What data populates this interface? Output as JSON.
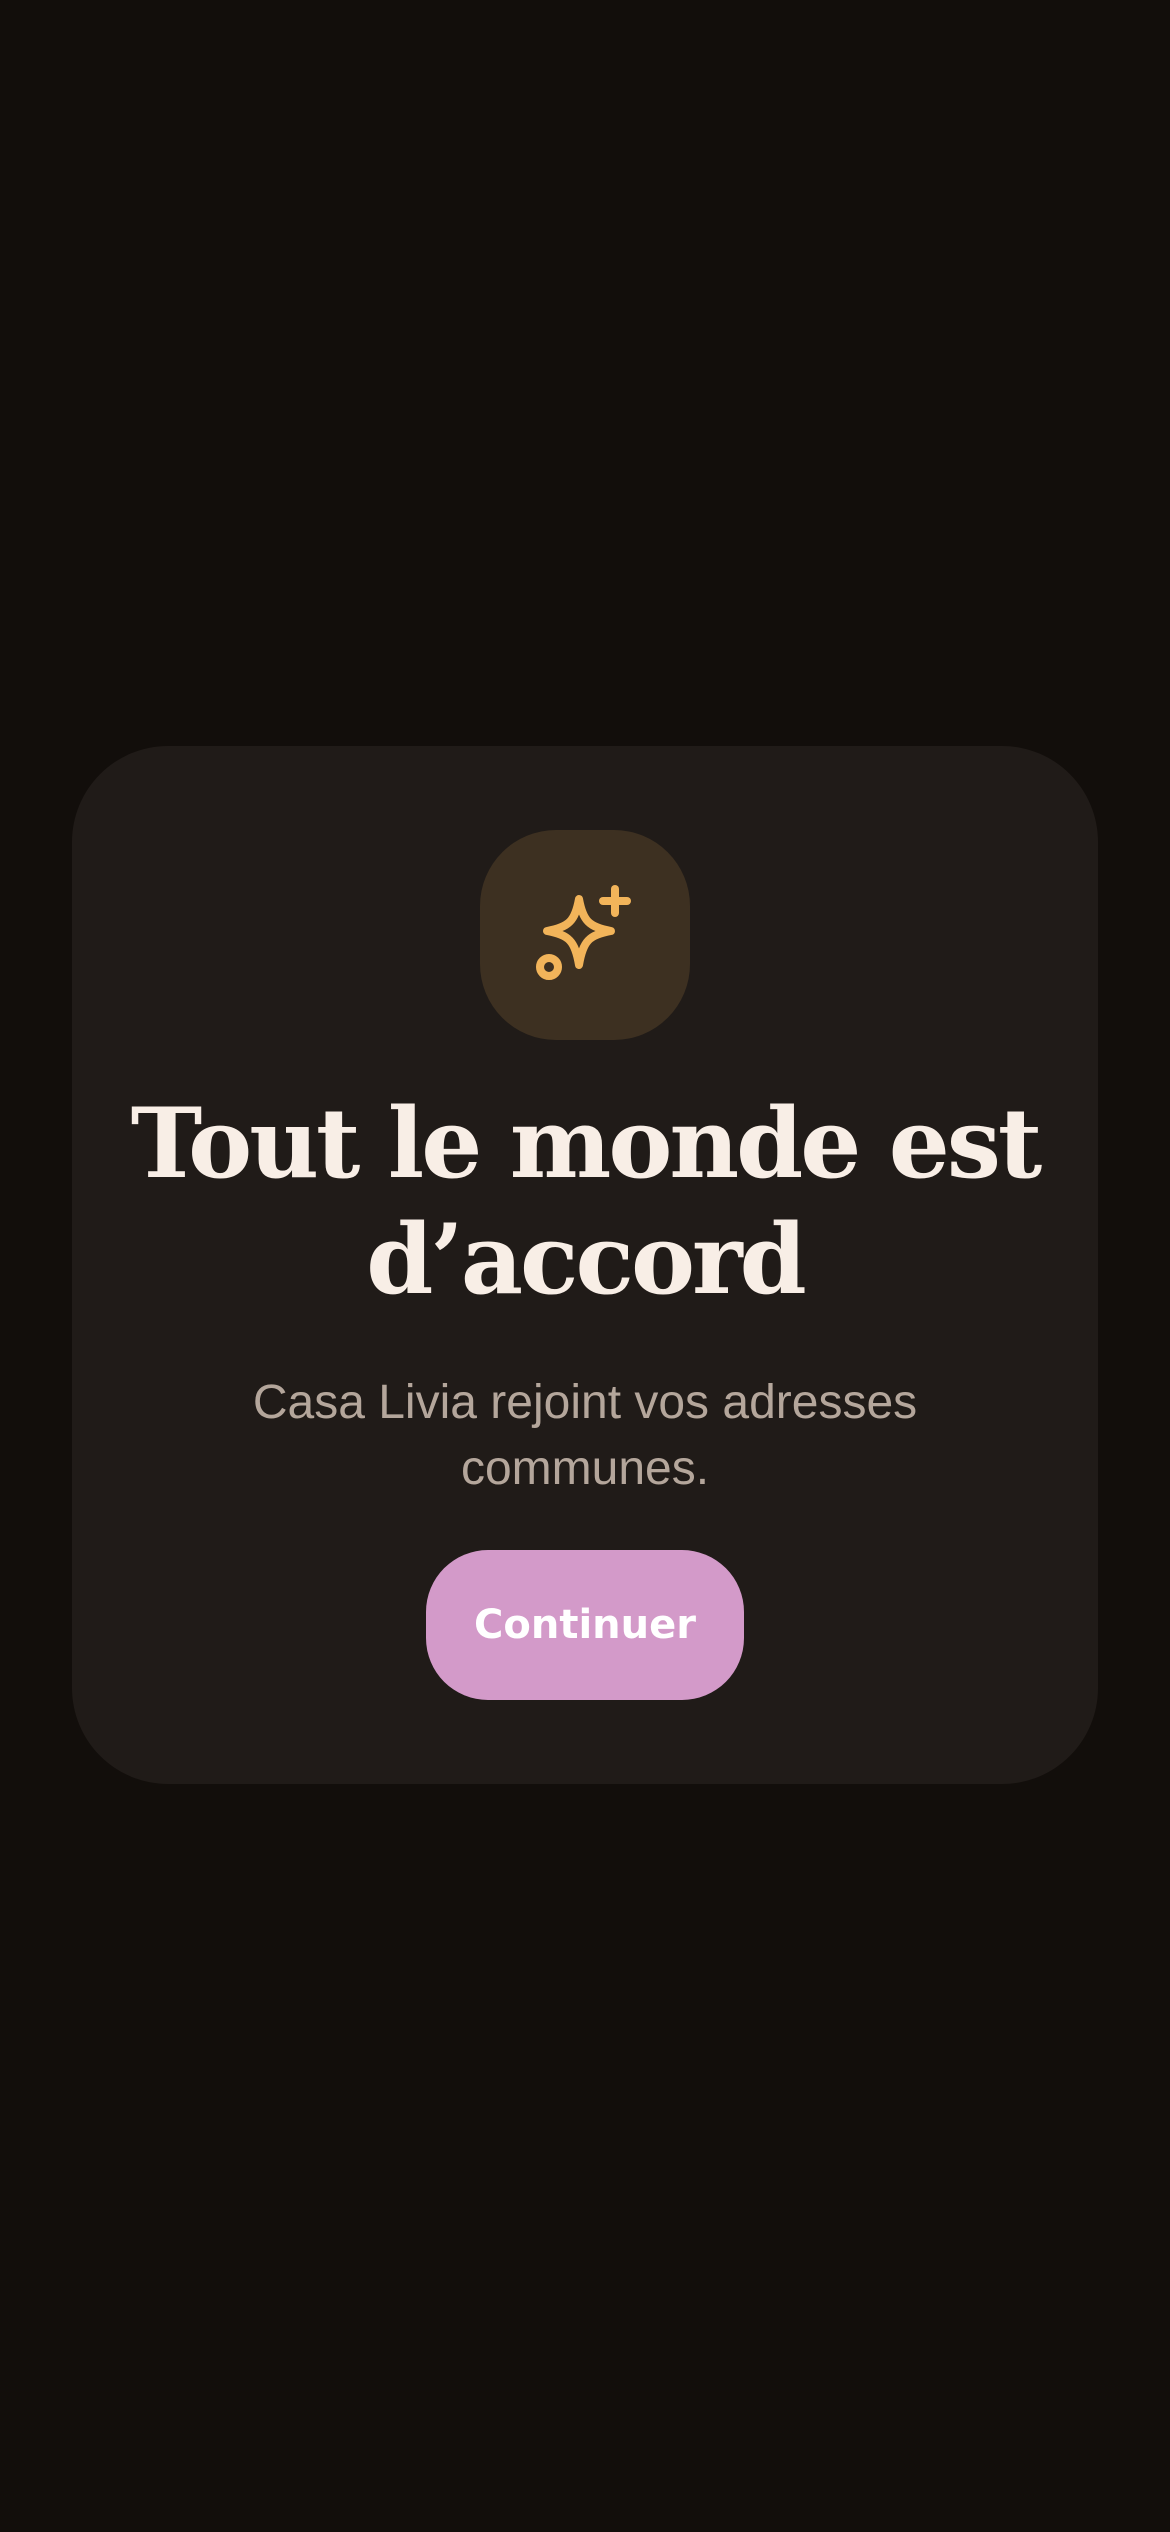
{
  "dialog": {
    "icon": "sparkles-icon",
    "title": "Tout le monde est d’accord",
    "message": "Casa Livia rejoint vos adresses communes.",
    "continue_label": "Continuer"
  },
  "colors": {
    "background": "#120e0b",
    "card": "#201b18",
    "icon_tile": "#3d3021",
    "icon": "#f2b45a",
    "title": "#f8eee6",
    "message": "#b4a69b",
    "button": "#d39ac9",
    "button_text": "#ffffff"
  }
}
